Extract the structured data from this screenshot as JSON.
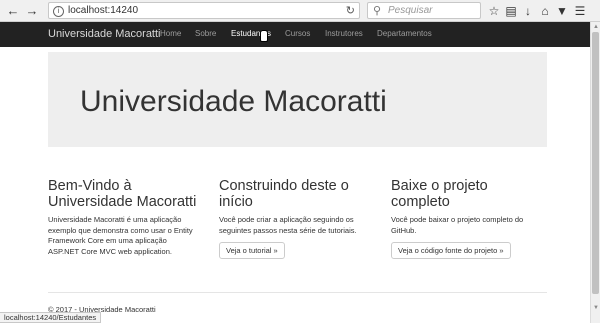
{
  "browser": {
    "url": "localhost:14240",
    "search_placeholder": "Pesquisar",
    "status_url": "localhost:14240/Estudantes"
  },
  "navbar": {
    "brand": "Universidade Macoratti",
    "links": [
      "Home",
      "Sobre",
      "Estudantes",
      "Cursos",
      "Instrutores",
      "Departamentos"
    ],
    "active_link": "Estudantes"
  },
  "jumbotron": {
    "title": "Universidade Macoratti"
  },
  "columns": [
    {
      "heading": "Bem-Vindo à Universidade Macoratti",
      "text": "Universidade Macoratti é uma aplicação exemplo que demonstra como usar o Entity Framework Core em uma aplicação ASP.NET Core MVC web application."
    },
    {
      "heading": "Construindo deste o início",
      "text": "Você pode criar a aplicação seguindo os seguintes passos nesta série de tutoriais.",
      "button": "Veja o tutorial »"
    },
    {
      "heading": "Baixe o projeto completo",
      "text": "Você pode baixar o projeto completo do GitHub.",
      "button": "Veja o código fonte do projeto »"
    }
  ],
  "footer": {
    "text": "© 2017 - Universidade Macoratti"
  },
  "colors": {
    "navbar_bg": "#222222",
    "jumbotron_bg": "#eeeeee",
    "nav_link": "#9d9d9d",
    "nav_active": "#ffffff"
  }
}
